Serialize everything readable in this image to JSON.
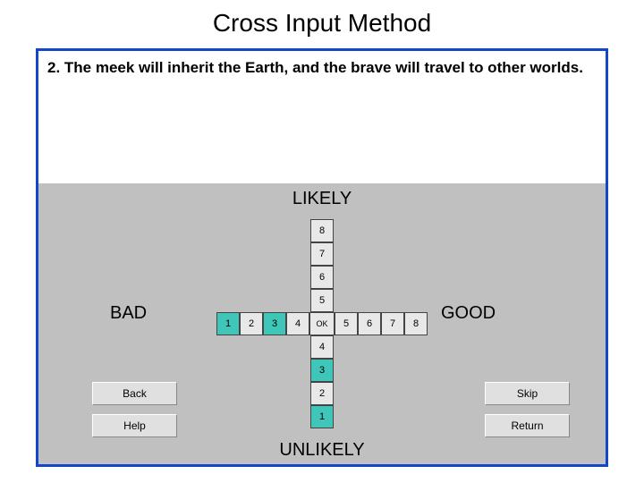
{
  "title": "Cross Input Method",
  "question": "2. The meek will inherit the Earth, and the brave will travel to other worlds.",
  "axes": {
    "top": "LIKELY",
    "bottom": "UNLIKELY",
    "left": "BAD",
    "right": "GOOD"
  },
  "center_label": "OK",
  "vertical": {
    "top": [
      "8",
      "7",
      "6",
      "5"
    ],
    "bottom": [
      "4",
      "3",
      "2",
      "1"
    ]
  },
  "horizontal": {
    "left": [
      "1",
      "2",
      "3",
      "4"
    ],
    "right": [
      "5",
      "6",
      "7",
      "8"
    ]
  },
  "highlighted_h_indices": [
    0,
    2
  ],
  "highlighted_v_bottom_indices": [
    1,
    3
  ],
  "buttons": {
    "back": "Back",
    "help": "Help",
    "skip": "Skip",
    "return": "Return"
  }
}
